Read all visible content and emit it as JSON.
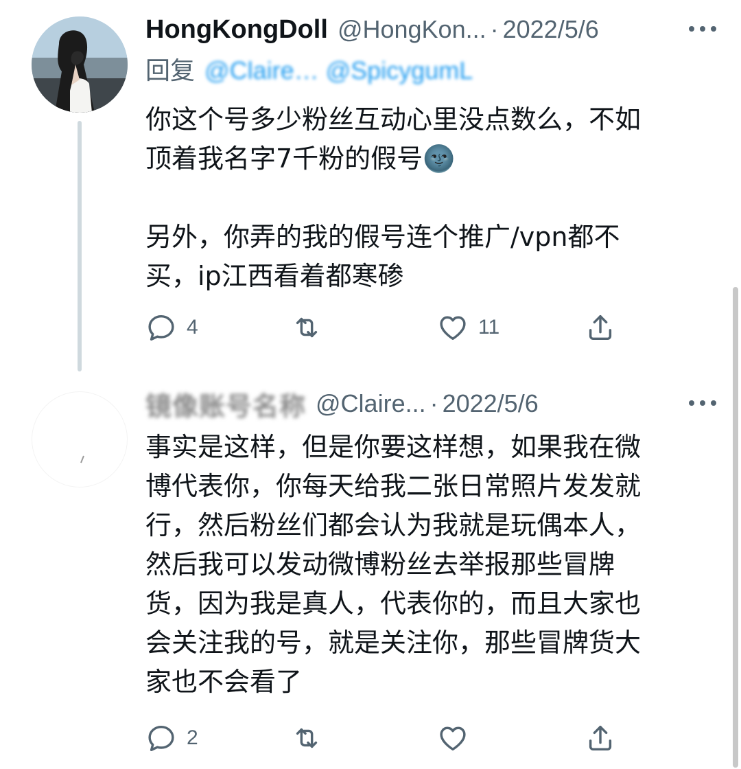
{
  "tweets": [
    {
      "display_name": "HongKongDoll",
      "handle": "@HongKon...",
      "separator": "·",
      "date": "2022/5/6",
      "reply_prefix": "回复",
      "reply_mentions": "@Claire… @SpicygumL",
      "body": "你这个号多少粉丝互动心里没点数么，不如\n顶着我名字7千粉的假号🌚\n\n另外，你弄的我的假号连个推广/vpn都不\n买，ip江西看着都寒碜",
      "reply_count": "4",
      "retweet_count": "",
      "like_count": "11"
    },
    {
      "display_name": "镜像账号名称",
      "handle": "@Claire...",
      "separator": "·",
      "date": "2022/5/6",
      "body": "事实是这样，但是你要这样想，如果我在微\n博代表你，你每天给我二张日常照片发发就\n行，然后粉丝们都会认为我就是玩偶本人，\n然后我可以发动微博粉丝去举报那些冒牌\n货，因为我是真人，代表你的，而且大家也\n会关注我的号，就是关注你，那些冒牌货大\n家也不会看了",
      "reply_count": "2",
      "retweet_count": "",
      "like_count": ""
    }
  ],
  "icons": {
    "reply": "reply-icon",
    "retweet": "retweet-icon",
    "like": "heart-icon",
    "share": "share-icon",
    "more": "more-icon"
  },
  "colors": {
    "text": "#0f1419",
    "secondary": "#536471",
    "link": "#1d9bf0",
    "thread_line": "#cfd9de"
  }
}
